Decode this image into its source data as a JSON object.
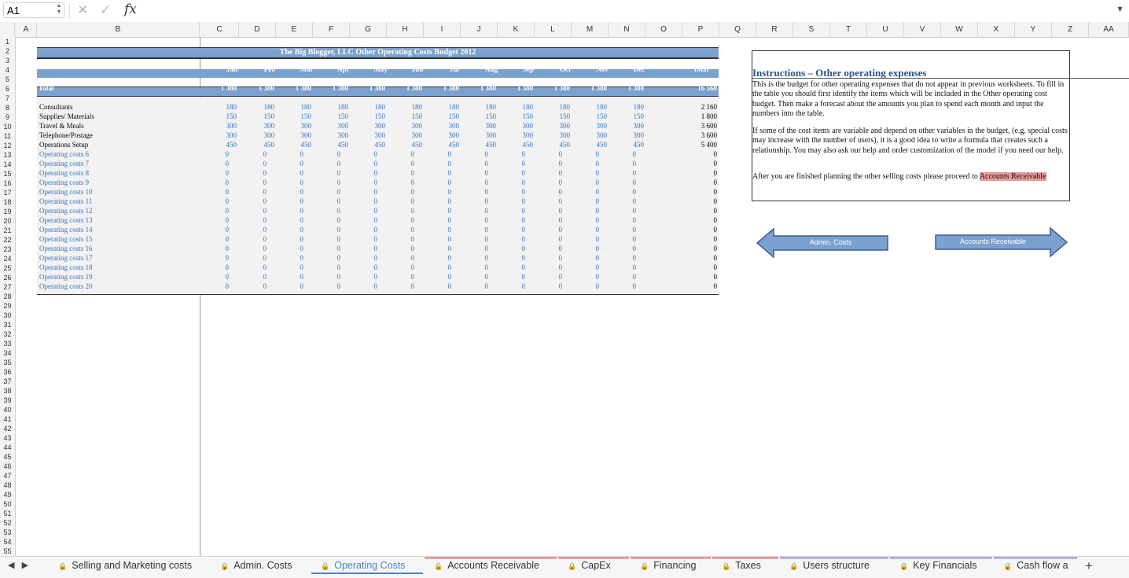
{
  "formula_bar": {
    "cell_ref": "A1",
    "cancel_icon": "✕",
    "confirm_icon": "✓",
    "fx_label": "fx",
    "formula": ""
  },
  "columns": [
    "A",
    "B",
    "C",
    "D",
    "E",
    "F",
    "G",
    "H",
    "I",
    "J",
    "K",
    "L",
    "M",
    "N",
    "O",
    "P",
    "Q",
    "R",
    "S",
    "T",
    "U",
    "V",
    "W",
    "X",
    "Y",
    "Z",
    "AA"
  ],
  "rows_visible": 55,
  "sheet": {
    "title": "The Big Blogger, LLC Other Operating Costs Budget 2012",
    "months": [
      "Jan",
      "Feb",
      "Mar",
      "Apr",
      "May",
      "Jun",
      "Jul",
      "Aug",
      "Sep",
      "Oct",
      "Nov",
      "Dec"
    ],
    "total_header": "Total",
    "total_row": {
      "label": "Total",
      "values": [
        "1 380",
        "1 380",
        "1 380",
        "1 380",
        "1 380",
        "1 380",
        "1 380",
        "1 380",
        "1 380",
        "1 380",
        "1 380",
        "1 380"
      ],
      "total": "16 560"
    },
    "items": [
      {
        "label": "Consultants",
        "values": [
          "180",
          "180",
          "180",
          "180",
          "180",
          "180",
          "180",
          "180",
          "180",
          "180",
          "180",
          "180"
        ],
        "total": "2 160",
        "label_color": "black"
      },
      {
        "label": "Supplies/ Materials",
        "values": [
          "150",
          "150",
          "150",
          "150",
          "150",
          "150",
          "150",
          "150",
          "150",
          "150",
          "150",
          "150"
        ],
        "total": "1 800",
        "label_color": "black"
      },
      {
        "label": "Travel & Meals",
        "values": [
          "300",
          "300",
          "300",
          "300",
          "300",
          "300",
          "300",
          "300",
          "300",
          "300",
          "300",
          "300"
        ],
        "total": "3 600",
        "label_color": "black"
      },
      {
        "label": "Telephone/Postage",
        "values": [
          "300",
          "300",
          "300",
          "300",
          "300",
          "300",
          "300",
          "300",
          "300",
          "300",
          "300",
          "300"
        ],
        "total": "3 600",
        "label_color": "black"
      },
      {
        "label": "Operations Setup",
        "values": [
          "450",
          "450",
          "450",
          "450",
          "450",
          "450",
          "450",
          "450",
          "450",
          "450",
          "450",
          "450"
        ],
        "total": "5 400",
        "label_color": "black"
      },
      {
        "label": "Operating costs 6",
        "values": [
          "0",
          "0",
          "0",
          "0",
          "0",
          "0",
          "0",
          "0",
          "0",
          "0",
          "0",
          "0"
        ],
        "total": "0",
        "label_color": "blue"
      },
      {
        "label": "Operating costs 7",
        "values": [
          "0",
          "0",
          "0",
          "0",
          "0",
          "0",
          "0",
          "0",
          "0",
          "0",
          "0",
          "0"
        ],
        "total": "0",
        "label_color": "blue"
      },
      {
        "label": "Operating costs 8",
        "values": [
          "0",
          "0",
          "0",
          "0",
          "0",
          "0",
          "0",
          "0",
          "0",
          "0",
          "0",
          "0"
        ],
        "total": "0",
        "label_color": "blue"
      },
      {
        "label": "Operating costs 9",
        "values": [
          "0",
          "0",
          "0",
          "0",
          "0",
          "0",
          "0",
          "0",
          "0",
          "0",
          "0",
          "0"
        ],
        "total": "0",
        "label_color": "blue"
      },
      {
        "label": "Operating costs 10",
        "values": [
          "0",
          "0",
          "0",
          "0",
          "0",
          "0",
          "0",
          "0",
          "0",
          "0",
          "0",
          "0"
        ],
        "total": "0",
        "label_color": "blue"
      },
      {
        "label": "Operating costs 11",
        "values": [
          "0",
          "0",
          "0",
          "0",
          "0",
          "0",
          "0",
          "0",
          "0",
          "0",
          "0",
          "0"
        ],
        "total": "0",
        "label_color": "blue"
      },
      {
        "label": "Operating costs 12",
        "values": [
          "0",
          "0",
          "0",
          "0",
          "0",
          "0",
          "0",
          "0",
          "0",
          "0",
          "0",
          "0"
        ],
        "total": "0",
        "label_color": "blue"
      },
      {
        "label": "Operating costs 13",
        "values": [
          "0",
          "0",
          "0",
          "0",
          "0",
          "0",
          "0",
          "0",
          "0",
          "0",
          "0",
          "0"
        ],
        "total": "0",
        "label_color": "blue"
      },
      {
        "label": "Operating costs 14",
        "values": [
          "0",
          "0",
          "0",
          "0",
          "0",
          "0",
          "0",
          "0",
          "0",
          "0",
          "0",
          "0"
        ],
        "total": "0",
        "label_color": "blue"
      },
      {
        "label": "Operating costs 15",
        "values": [
          "0",
          "0",
          "0",
          "0",
          "0",
          "0",
          "0",
          "0",
          "0",
          "0",
          "0",
          "0"
        ],
        "total": "0",
        "label_color": "blue"
      },
      {
        "label": "Operating costs 16",
        "values": [
          "0",
          "0",
          "0",
          "0",
          "0",
          "0",
          "0",
          "0",
          "0",
          "0",
          "0",
          "0"
        ],
        "total": "0",
        "label_color": "blue"
      },
      {
        "label": "Operating costs 17",
        "values": [
          "0",
          "0",
          "0",
          "0",
          "0",
          "0",
          "0",
          "0",
          "0",
          "0",
          "0",
          "0"
        ],
        "total": "0",
        "label_color": "blue"
      },
      {
        "label": "Operating costs 18",
        "values": [
          "0",
          "0",
          "0",
          "0",
          "0",
          "0",
          "0",
          "0",
          "0",
          "0",
          "0",
          "0"
        ],
        "total": "0",
        "label_color": "blue"
      },
      {
        "label": "Operating costs 19",
        "values": [
          "0",
          "0",
          "0",
          "0",
          "0",
          "0",
          "0",
          "0",
          "0",
          "0",
          "0",
          "0"
        ],
        "total": "0",
        "label_color": "blue"
      },
      {
        "label": "Operating costs 20",
        "values": [
          "0",
          "0",
          "0",
          "0",
          "0",
          "0",
          "0",
          "0",
          "0",
          "0",
          "0",
          "0"
        ],
        "total": "0",
        "label_color": "blue"
      }
    ]
  },
  "instructions": {
    "title": "Instructions – Other operating expenses",
    "p1": "This is the budget for other operating expenses that do not appear in previous worksheets. To fill in the table you should first identify the items which will be included in the Other operating cost budget. Then make a forecast about the amounts you plan to spend each month and input the numbers into the table.",
    "p2": "If some of the cost items are variable and depend on other variables in the budget, (e.g. special costs may increase with the number of users), it is a good idea to write a formula that creates such a relationship. You may also ask our help and order customization of the model if you need our help.",
    "p3_prefix": "After you are finished planning the other selling costs please proceed to ",
    "p3_link": "Accounts Receivable"
  },
  "nav_buttons": {
    "back": "Admin. Costs",
    "forward": "Accounts Receivable"
  },
  "tabs": [
    {
      "label": "Selling and Marketing costs",
      "locked": true,
      "active": false,
      "stripe": ""
    },
    {
      "label": "Admin. Costs",
      "locked": true,
      "active": false,
      "stripe": ""
    },
    {
      "label": "Operating Costs",
      "locked": true,
      "active": true,
      "stripe": ""
    },
    {
      "label": "Accounts Receivable",
      "locked": true,
      "active": false,
      "stripe": "#e6a0a0"
    },
    {
      "label": "CapEx",
      "locked": true,
      "active": false,
      "stripe": "#e6a0a0"
    },
    {
      "label": "Financing",
      "locked": true,
      "active": false,
      "stripe": "#e6a0a0"
    },
    {
      "label": "Taxes",
      "locked": true,
      "active": false,
      "stripe": "#e6a0a0"
    },
    {
      "label": "Users structure",
      "locked": true,
      "active": false,
      "stripe": "#b9b0d8"
    },
    {
      "label": "Key Financials",
      "locked": true,
      "active": false,
      "stripe": "#b9b0d8"
    },
    {
      "label": "Cash flow a",
      "locked": true,
      "active": false,
      "stripe": "#b9b0d8"
    }
  ],
  "colors": {
    "header_band": "#7ba1cf",
    "input_blue": "#2f73c6",
    "active_tab": "#4a86c8",
    "highlight": "#e89a9a"
  }
}
